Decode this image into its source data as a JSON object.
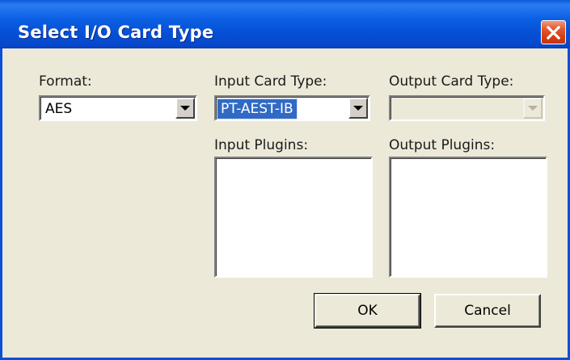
{
  "window": {
    "title": "Select I/O Card Type",
    "close_icon": "close-icon",
    "accent_color": "#0a4fd8",
    "close_color": "#d43e15"
  },
  "format": {
    "label": "Format:",
    "value": "AES"
  },
  "input_card_type": {
    "label": "Input Card Type:",
    "value": "PT-AEST-IB",
    "selected": true
  },
  "output_card_type": {
    "label": "Output Card Type:",
    "value": "",
    "disabled": true
  },
  "input_plugins": {
    "label": "Input Plugins:",
    "items": []
  },
  "output_plugins": {
    "label": "Output Plugins:",
    "items": []
  },
  "buttons": {
    "ok_label": "OK",
    "cancel_label": "Cancel"
  },
  "icons": {
    "dropdown_arrow": "chevron-down-icon"
  }
}
